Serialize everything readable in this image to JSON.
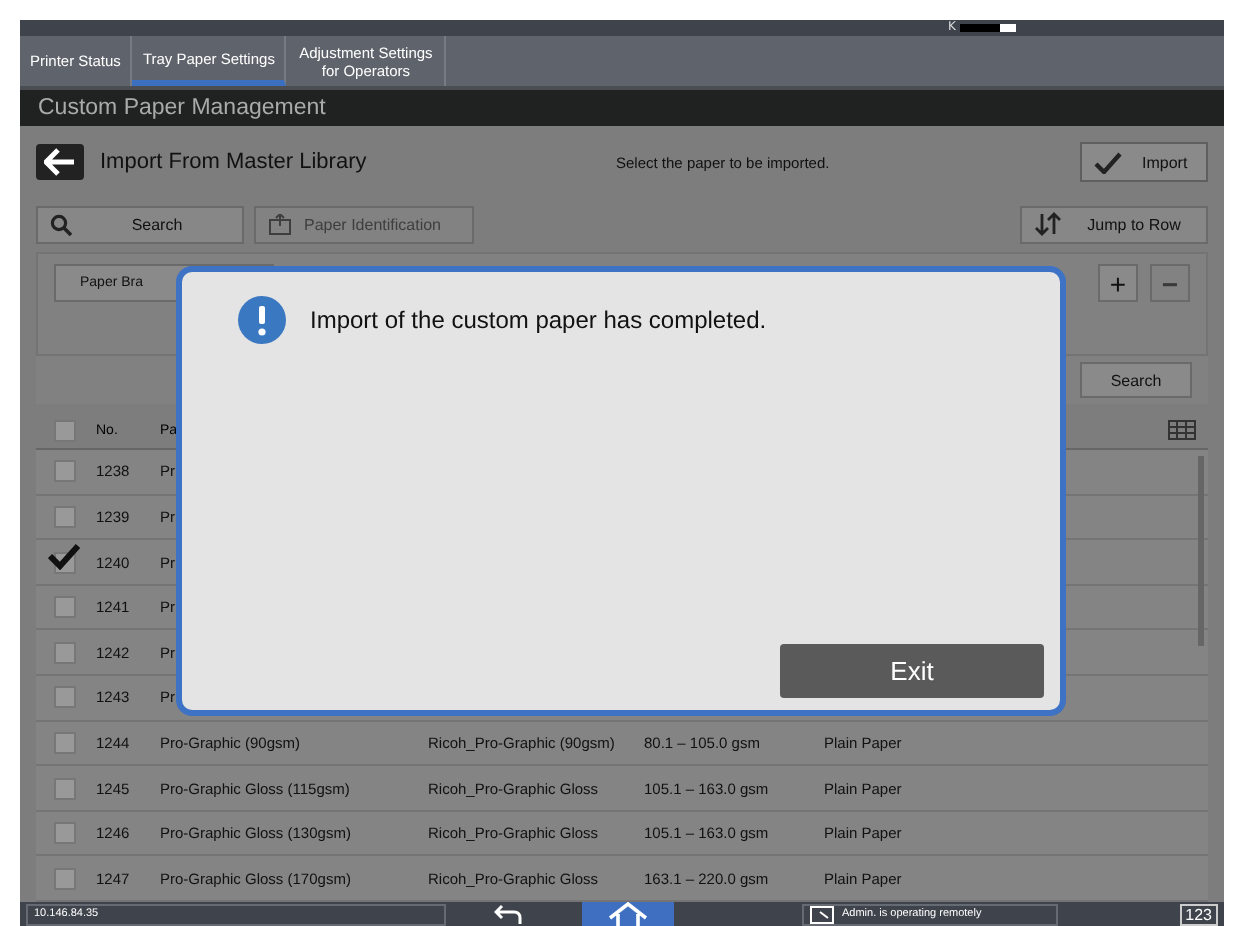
{
  "status_strip": {
    "toner_label": "K"
  },
  "tabs": [
    {
      "label": "Printer Status",
      "selected": false
    },
    {
      "label": "Tray Paper Settings",
      "selected": true
    },
    {
      "label": "Adjustment Settings for Operators",
      "selected": false
    }
  ],
  "screen_title": "Custom Paper Management",
  "header": {
    "title": "Import From Master Library",
    "instruction": "Select the paper to be imported.",
    "import_button": "Import"
  },
  "toolbar": {
    "search": "Search",
    "paper_identification": {
      "label": "Paper Identification",
      "disabled": true
    },
    "jump_to_row": "Jump to Row"
  },
  "filter": {
    "paper_brand_button": "Paper Bra",
    "add_button": {
      "label": "+",
      "disabled": false
    },
    "remove_button": {
      "label": "−",
      "disabled": true
    },
    "search_button": "Search"
  },
  "table": {
    "select_all_checked": false,
    "columns": [
      "No.",
      "Pa"
    ],
    "rows": [
      {
        "checked": false,
        "cells": [
          "1238",
          "Pr"
        ]
      },
      {
        "checked": false,
        "cells": [
          "1239",
          "Pr"
        ]
      },
      {
        "checked": true,
        "cells": [
          "1240",
          "Pr"
        ]
      },
      {
        "checked": false,
        "cells": [
          "1241",
          "Pr"
        ]
      },
      {
        "checked": false,
        "cells": [
          "1242",
          "Pr"
        ]
      },
      {
        "checked": false,
        "cells": [
          "1243",
          "Pr"
        ]
      },
      {
        "checked": false,
        "cells": [
          "1244",
          "Pro-Graphic (90gsm)",
          "Ricoh_Pro-Graphic (90gsm)",
          "80.1 – 105.0 gsm",
          "Plain Paper"
        ]
      },
      {
        "checked": false,
        "cells": [
          "1245",
          "Pro-Graphic Gloss (115gsm)",
          "Ricoh_Pro-Graphic Gloss",
          "105.1 – 163.0 gsm",
          "Plain Paper"
        ]
      },
      {
        "checked": false,
        "cells": [
          "1246",
          "Pro-Graphic Gloss (130gsm)",
          "Ricoh_Pro-Graphic Gloss",
          "105.1 – 163.0 gsm",
          "Plain Paper"
        ]
      },
      {
        "checked": false,
        "cells": [
          "1247",
          "Pro-Graphic Gloss (170gsm)",
          "Ricoh_Pro-Graphic Gloss",
          "163.1 – 220.0 gsm",
          "Plain Paper"
        ]
      }
    ]
  },
  "bottom_bar": {
    "ip": "10.146.84.35",
    "remote_status": "Admin. is operating remotely",
    "keypad": "123"
  },
  "dialog": {
    "message": "Import of the custom paper has completed.",
    "exit_button": "Exit"
  }
}
